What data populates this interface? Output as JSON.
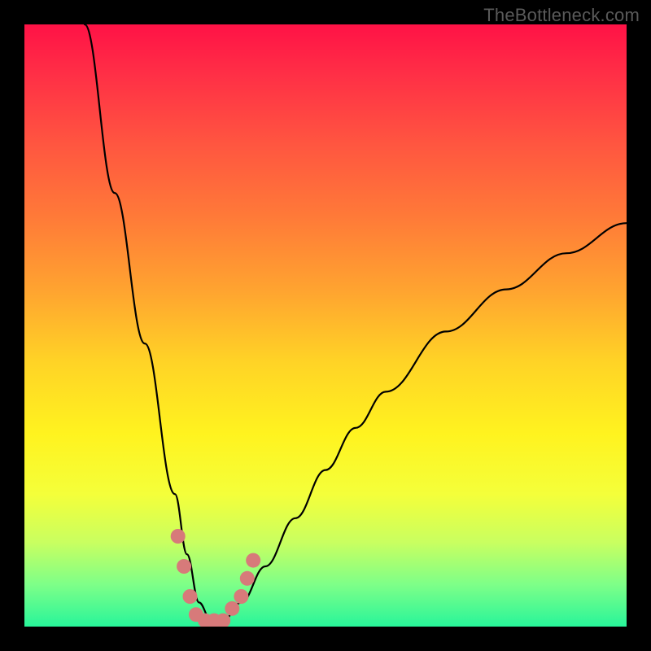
{
  "watermark": "TheBottleneck.com",
  "chart_data": {
    "type": "line",
    "title": "",
    "xlabel": "",
    "ylabel": "",
    "xlim": [
      0,
      100
    ],
    "ylim": [
      0,
      100
    ],
    "grid": false,
    "legend": false,
    "series": [
      {
        "name": "bottleneck-curve",
        "x": [
          10,
          15,
          20,
          25,
          27,
          29,
          31,
          33,
          36,
          40,
          45,
          50,
          55,
          60,
          70,
          80,
          90,
          100
        ],
        "values": [
          100,
          72,
          47,
          22,
          12,
          4,
          1,
          1,
          4,
          10,
          18,
          26,
          33,
          39,
          49,
          56,
          62,
          67
        ]
      }
    ],
    "markers": {
      "name": "sample-points",
      "color": "#d77a7a",
      "points": [
        {
          "x": 25.5,
          "y": 15
        },
        {
          "x": 26.5,
          "y": 10
        },
        {
          "x": 27.5,
          "y": 5
        },
        {
          "x": 28.5,
          "y": 2
        },
        {
          "x": 30.0,
          "y": 1
        },
        {
          "x": 31.5,
          "y": 1
        },
        {
          "x": 33.0,
          "y": 1
        },
        {
          "x": 34.5,
          "y": 3
        },
        {
          "x": 36.0,
          "y": 5
        },
        {
          "x": 37.0,
          "y": 8
        },
        {
          "x": 38.0,
          "y": 11
        }
      ]
    }
  }
}
